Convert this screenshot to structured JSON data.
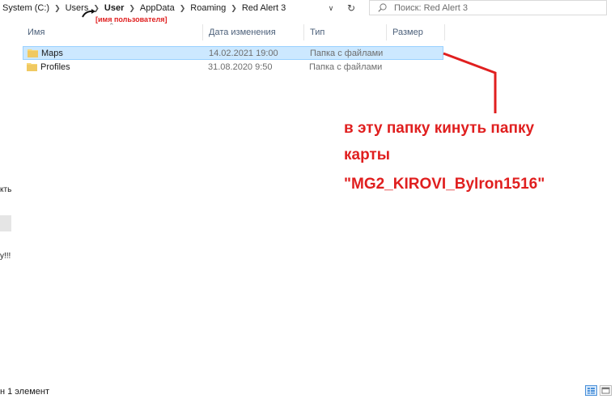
{
  "address": {
    "crumbs": [
      {
        "label": "System (C:)"
      },
      {
        "label": "Users"
      },
      {
        "label": "User"
      },
      {
        "label": "AppData"
      },
      {
        "label": "Roaming"
      },
      {
        "label": "Red Alert 3"
      }
    ],
    "user_annotation": "[имя пользователя]"
  },
  "search": {
    "placeholder": "Поиск: Red Alert 3"
  },
  "columns": {
    "name": "Имя",
    "date": "Дата изменения",
    "type": "Тип",
    "size": "Размер"
  },
  "rows": [
    {
      "name": "Maps",
      "date": "14.02.2021 19:00",
      "type": "Папка с файлами",
      "selected": true
    },
    {
      "name": "Profiles",
      "date": "31.08.2020 9:50",
      "type": "Папка с файлами",
      "selected": false
    }
  ],
  "left_pane": {
    "text1": "кть",
    "text2": "у!!!"
  },
  "status": {
    "text": "н 1 элемент"
  },
  "annotation": {
    "line1": "в эту папку кинуть папку",
    "line2": "карты",
    "line3": "\"MG2_KIROVI_Bylron1516\"",
    "color": "#e01f1f"
  },
  "colors": {
    "selection": "#cce8ff",
    "selection_border": "#99d1ff",
    "header_text": "#4c607a",
    "folder": "#f8d775"
  }
}
